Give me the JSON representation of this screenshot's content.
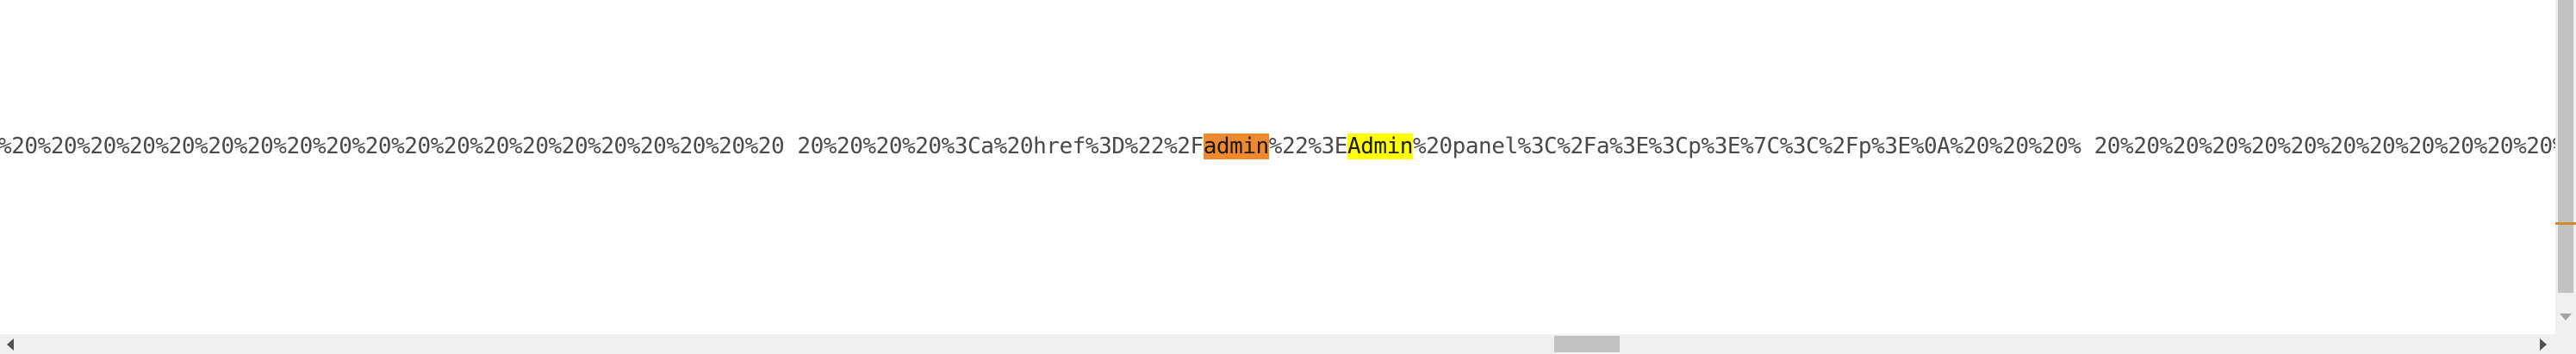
{
  "document": {
    "line_before": "%20%20%20%20%20%20%20%20%20%20%20%20%20%20%20%20%20%20%20%20 20%20%20%20%3Ca%20href%3D%22%2F",
    "current_match": "admin",
    "line_between": "%22%3E",
    "other_match": "Admin",
    "line_after": "%20panel%3C%2Fa%3E%3Cp%3E%7C%3C%2Fp%3E%0A%20%20%20% 20%20%20%20%20%20%20%20%20%20%20%20%"
  },
  "highlight_colors": {
    "current_match": "#f0882e",
    "other_match": "#ffff00"
  },
  "icons": {
    "scroll_left": "left-arrow-icon",
    "scroll_right": "right-arrow-icon",
    "scroll_down": "down-arrow-icon"
  }
}
